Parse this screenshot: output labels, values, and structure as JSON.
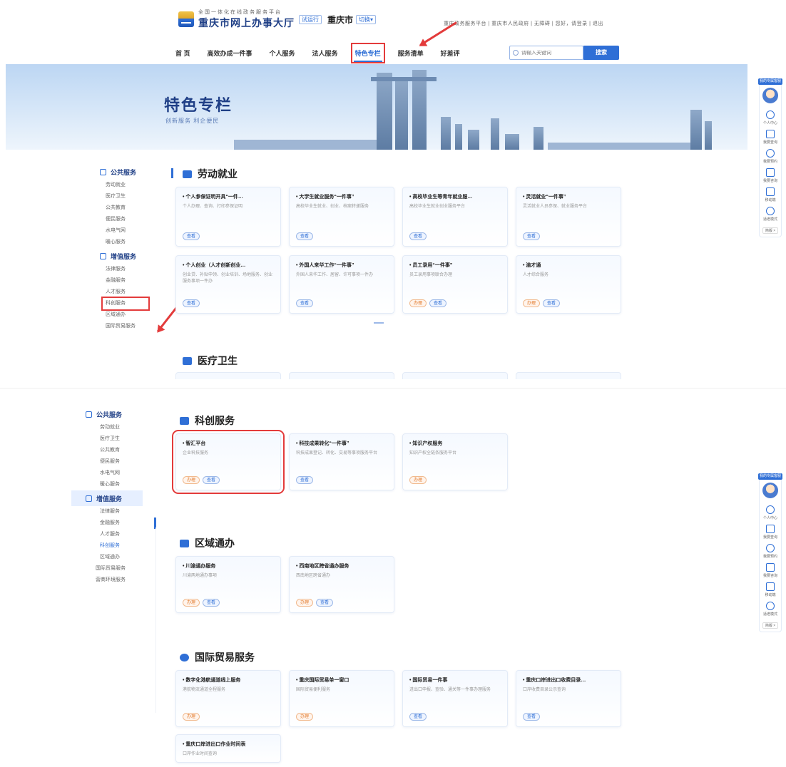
{
  "header": {
    "logo_sub": "全国一体化在线政务服务平台",
    "logo_title": "重庆市网上办事大厅",
    "logo_badge": "试运行",
    "city": "重庆市",
    "city_switch": "切换▾",
    "toplinks": "重庆政务服务平台 | 重庆市人民政府 | 无障碍 | 您好，请登录 | 退出"
  },
  "nav": {
    "items": [
      "首 页",
      "高效办成一件事",
      "个人服务",
      "法人服务",
      "特色专栏",
      "服务清单",
      "好差评"
    ],
    "active_index": 4,
    "search_placeholder": "请输入关键词",
    "search_button": "搜索"
  },
  "banner": {
    "title": "特色专栏",
    "subtitle": "创新服务 利企便民"
  },
  "sidebar_top": {
    "cat1": "公共服务",
    "cat1_items": [
      "劳动就业",
      "医疗卫生",
      "公共教育",
      "便民服务",
      "水电气网",
      "暖心服务"
    ],
    "cat2": "增值服务",
    "cat2_items": [
      "法律服务",
      "金融服务",
      "人才服务",
      "科创服务",
      "区域通办",
      "国际贸易服务"
    ]
  },
  "sidebar_bottom": {
    "cat1": "公共服务",
    "cat1_items": [
      "劳动就业",
      "医疗卫生",
      "公共教育",
      "便民服务",
      "水电气网",
      "暖心服务"
    ],
    "cat2": "增值服务",
    "cat2_items": [
      "法律服务",
      "金融服务",
      "人才服务",
      "科创服务",
      "区域通办",
      "国际贸易服务",
      "营商环境服务"
    ]
  },
  "section_labor": {
    "title": "劳动就业",
    "cards": [
      {
        "title": "• 个人参保证明开具“一件…",
        "desc": "个人办理、查询、打印参保证明",
        "tags": [
          "查看"
        ]
      },
      {
        "title": "• 大学生就业服务“一件事”",
        "desc": "高校毕业生就业、创业、档案转递服务",
        "tags": [
          "查看"
        ]
      },
      {
        "title": "• 高校毕业生等青年就业服…",
        "desc": "高校毕业生就业创业服务平台",
        "tags": [
          "查看"
        ]
      },
      {
        "title": "• 灵活就业“一件事”",
        "desc": "灵活就业人员参保、就业服务平台",
        "tags": [
          "查看"
        ]
      },
      {
        "title": "• 个人创业（人才创新创业…",
        "desc": "创业贷、补贴申领、创业培训、场地服务、创业服务事项一件办",
        "tags": [
          "查看"
        ]
      },
      {
        "title": "• 外国人来华工作“一件事”",
        "desc": "外国人来华工作、居留、许可事项一件办",
        "tags": [
          "查看"
        ]
      },
      {
        "title": "• 员工录用“一件事”",
        "desc": "员工录用事项联合办理",
        "tags": [
          "办理",
          "查看"
        ]
      },
      {
        "title": "• 渝才通",
        "desc": "人才综合服务",
        "tags": [
          "办理",
          "查看"
        ]
      }
    ]
  },
  "section_medical": {
    "title": "医疗卫生"
  },
  "section_science": {
    "title": "科创服务",
    "cards": [
      {
        "title": "• 智汇平台",
        "desc": "企业科技服务",
        "tags": [
          "办理",
          "查看"
        ]
      },
      {
        "title": "• 科技成果转化“一件事”",
        "desc": "科技成果登记、转化、交易等事项服务平台",
        "tags": [
          "查看"
        ]
      },
      {
        "title": "• 知识产权服务",
        "desc": "知识产权全链条服务平台",
        "tags": [
          "办理"
        ]
      }
    ]
  },
  "section_region": {
    "title": "区域通办",
    "cards": [
      {
        "title": "• 川渝通办服务",
        "desc": "川渝两地通办事项",
        "tags": [
          "办理",
          "查看"
        ]
      },
      {
        "title": "• 西南地区跨省通办服务",
        "desc": "西南地区跨省通办",
        "tags": [
          "办理",
          "查看"
        ]
      }
    ]
  },
  "section_trade": {
    "title": "国际贸易服务",
    "cards": [
      {
        "title": "• 数字化港航通道线上服务",
        "desc": "港航物流通道全程服务",
        "tags": [
          "办理"
        ]
      },
      {
        "title": "• 重庆国际贸易单一窗口",
        "desc": "国际贸易便利服务",
        "tags": [
          "办理"
        ]
      },
      {
        "title": "• 国际贸易一件事",
        "desc": "进出口申报、查验、通关等一件事办理服务",
        "tags": [
          "查看"
        ]
      },
      {
        "title": "• 重庆口岸进出口收费目录…",
        "desc": "口岸收费目录公示查询",
        "tags": [
          "查看"
        ]
      },
      {
        "title": "• 重庆口岸进出口作业时间表",
        "desc": "口岸作业时间查询",
        "tags": []
      }
    ]
  },
  "floatbar": {
    "badge": "我的专属客服",
    "items": [
      "个人中心",
      "我要查询",
      "我要预约",
      "我要咨询",
      "移动端",
      "适老模式"
    ],
    "mode": "简版 ×"
  },
  "colors": {
    "primary": "#2f6fd6",
    "highlight": "#e33b3b",
    "tag_orange": "#e27a2c"
  }
}
